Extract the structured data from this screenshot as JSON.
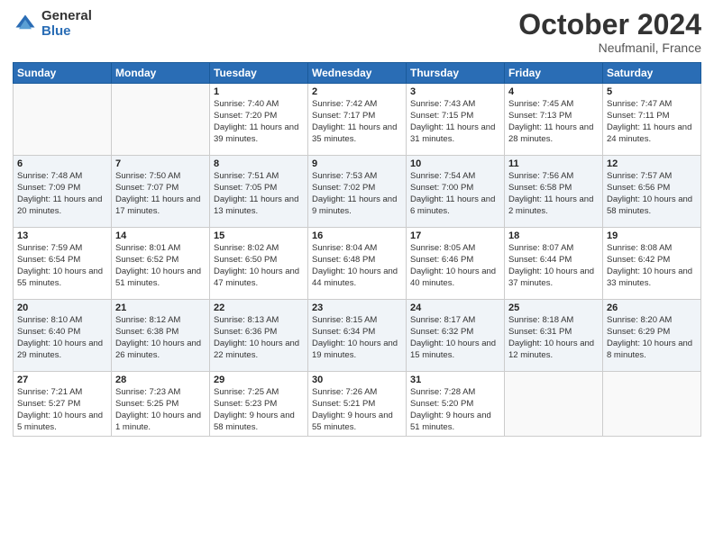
{
  "header": {
    "logo_general": "General",
    "logo_blue": "Blue",
    "month_title": "October 2024",
    "location": "Neufmanil, France"
  },
  "weekdays": [
    "Sunday",
    "Monday",
    "Tuesday",
    "Wednesday",
    "Thursday",
    "Friday",
    "Saturday"
  ],
  "weeks": [
    [
      {
        "day": "",
        "sunrise": "",
        "sunset": "",
        "daylight": ""
      },
      {
        "day": "",
        "sunrise": "",
        "sunset": "",
        "daylight": ""
      },
      {
        "day": "1",
        "sunrise": "Sunrise: 7:40 AM",
        "sunset": "Sunset: 7:20 PM",
        "daylight": "Daylight: 11 hours and 39 minutes."
      },
      {
        "day": "2",
        "sunrise": "Sunrise: 7:42 AM",
        "sunset": "Sunset: 7:17 PM",
        "daylight": "Daylight: 11 hours and 35 minutes."
      },
      {
        "day": "3",
        "sunrise": "Sunrise: 7:43 AM",
        "sunset": "Sunset: 7:15 PM",
        "daylight": "Daylight: 11 hours and 31 minutes."
      },
      {
        "day": "4",
        "sunrise": "Sunrise: 7:45 AM",
        "sunset": "Sunset: 7:13 PM",
        "daylight": "Daylight: 11 hours and 28 minutes."
      },
      {
        "day": "5",
        "sunrise": "Sunrise: 7:47 AM",
        "sunset": "Sunset: 7:11 PM",
        "daylight": "Daylight: 11 hours and 24 minutes."
      }
    ],
    [
      {
        "day": "6",
        "sunrise": "Sunrise: 7:48 AM",
        "sunset": "Sunset: 7:09 PM",
        "daylight": "Daylight: 11 hours and 20 minutes."
      },
      {
        "day": "7",
        "sunrise": "Sunrise: 7:50 AM",
        "sunset": "Sunset: 7:07 PM",
        "daylight": "Daylight: 11 hours and 17 minutes."
      },
      {
        "day": "8",
        "sunrise": "Sunrise: 7:51 AM",
        "sunset": "Sunset: 7:05 PM",
        "daylight": "Daylight: 11 hours and 13 minutes."
      },
      {
        "day": "9",
        "sunrise": "Sunrise: 7:53 AM",
        "sunset": "Sunset: 7:02 PM",
        "daylight": "Daylight: 11 hours and 9 minutes."
      },
      {
        "day": "10",
        "sunrise": "Sunrise: 7:54 AM",
        "sunset": "Sunset: 7:00 PM",
        "daylight": "Daylight: 11 hours and 6 minutes."
      },
      {
        "day": "11",
        "sunrise": "Sunrise: 7:56 AM",
        "sunset": "Sunset: 6:58 PM",
        "daylight": "Daylight: 11 hours and 2 minutes."
      },
      {
        "day": "12",
        "sunrise": "Sunrise: 7:57 AM",
        "sunset": "Sunset: 6:56 PM",
        "daylight": "Daylight: 10 hours and 58 minutes."
      }
    ],
    [
      {
        "day": "13",
        "sunrise": "Sunrise: 7:59 AM",
        "sunset": "Sunset: 6:54 PM",
        "daylight": "Daylight: 10 hours and 55 minutes."
      },
      {
        "day": "14",
        "sunrise": "Sunrise: 8:01 AM",
        "sunset": "Sunset: 6:52 PM",
        "daylight": "Daylight: 10 hours and 51 minutes."
      },
      {
        "day": "15",
        "sunrise": "Sunrise: 8:02 AM",
        "sunset": "Sunset: 6:50 PM",
        "daylight": "Daylight: 10 hours and 47 minutes."
      },
      {
        "day": "16",
        "sunrise": "Sunrise: 8:04 AM",
        "sunset": "Sunset: 6:48 PM",
        "daylight": "Daylight: 10 hours and 44 minutes."
      },
      {
        "day": "17",
        "sunrise": "Sunrise: 8:05 AM",
        "sunset": "Sunset: 6:46 PM",
        "daylight": "Daylight: 10 hours and 40 minutes."
      },
      {
        "day": "18",
        "sunrise": "Sunrise: 8:07 AM",
        "sunset": "Sunset: 6:44 PM",
        "daylight": "Daylight: 10 hours and 37 minutes."
      },
      {
        "day": "19",
        "sunrise": "Sunrise: 8:08 AM",
        "sunset": "Sunset: 6:42 PM",
        "daylight": "Daylight: 10 hours and 33 minutes."
      }
    ],
    [
      {
        "day": "20",
        "sunrise": "Sunrise: 8:10 AM",
        "sunset": "Sunset: 6:40 PM",
        "daylight": "Daylight: 10 hours and 29 minutes."
      },
      {
        "day": "21",
        "sunrise": "Sunrise: 8:12 AM",
        "sunset": "Sunset: 6:38 PM",
        "daylight": "Daylight: 10 hours and 26 minutes."
      },
      {
        "day": "22",
        "sunrise": "Sunrise: 8:13 AM",
        "sunset": "Sunset: 6:36 PM",
        "daylight": "Daylight: 10 hours and 22 minutes."
      },
      {
        "day": "23",
        "sunrise": "Sunrise: 8:15 AM",
        "sunset": "Sunset: 6:34 PM",
        "daylight": "Daylight: 10 hours and 19 minutes."
      },
      {
        "day": "24",
        "sunrise": "Sunrise: 8:17 AM",
        "sunset": "Sunset: 6:32 PM",
        "daylight": "Daylight: 10 hours and 15 minutes."
      },
      {
        "day": "25",
        "sunrise": "Sunrise: 8:18 AM",
        "sunset": "Sunset: 6:31 PM",
        "daylight": "Daylight: 10 hours and 12 minutes."
      },
      {
        "day": "26",
        "sunrise": "Sunrise: 8:20 AM",
        "sunset": "Sunset: 6:29 PM",
        "daylight": "Daylight: 10 hours and 8 minutes."
      }
    ],
    [
      {
        "day": "27",
        "sunrise": "Sunrise: 7:21 AM",
        "sunset": "Sunset: 5:27 PM",
        "daylight": "Daylight: 10 hours and 5 minutes."
      },
      {
        "day": "28",
        "sunrise": "Sunrise: 7:23 AM",
        "sunset": "Sunset: 5:25 PM",
        "daylight": "Daylight: 10 hours and 1 minute."
      },
      {
        "day": "29",
        "sunrise": "Sunrise: 7:25 AM",
        "sunset": "Sunset: 5:23 PM",
        "daylight": "Daylight: 9 hours and 58 minutes."
      },
      {
        "day": "30",
        "sunrise": "Sunrise: 7:26 AM",
        "sunset": "Sunset: 5:21 PM",
        "daylight": "Daylight: 9 hours and 55 minutes."
      },
      {
        "day": "31",
        "sunrise": "Sunrise: 7:28 AM",
        "sunset": "Sunset: 5:20 PM",
        "daylight": "Daylight: 9 hours and 51 minutes."
      },
      {
        "day": "",
        "sunrise": "",
        "sunset": "",
        "daylight": ""
      },
      {
        "day": "",
        "sunrise": "",
        "sunset": "",
        "daylight": ""
      }
    ]
  ]
}
